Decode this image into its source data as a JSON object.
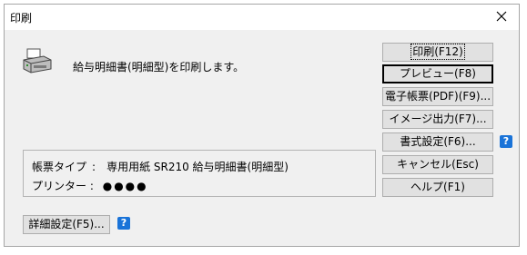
{
  "window": {
    "title": "印刷"
  },
  "icons": {
    "close": "close-icon",
    "printer": "printer-icon",
    "help": "help-icon"
  },
  "message": "給与明細書(明細型)を印刷します。",
  "buttons": {
    "print": "印刷(F12)",
    "preview": "プレビュー(F8)",
    "electronic": "電子帳票(PDF)(F9)...",
    "image": "イメージ出力(F7)...",
    "format": "書式設定(F6)...",
    "cancel": "キャンセル(Esc)",
    "help": "ヘルプ(F1)",
    "detail": "詳細設定(F5)..."
  },
  "info": {
    "form_label": "帳票タイプ",
    "separator": ":",
    "form_value": "専用用紙 SR210 給与明細書(明細型)",
    "printer_label": "プリンター",
    "printer_value": "●●●●"
  },
  "help_mark": "?",
  "colors": {
    "help_icon": "#1a73d8",
    "dialog_bg": "#f0f0f0",
    "button_bg": "#e1e1e1"
  }
}
